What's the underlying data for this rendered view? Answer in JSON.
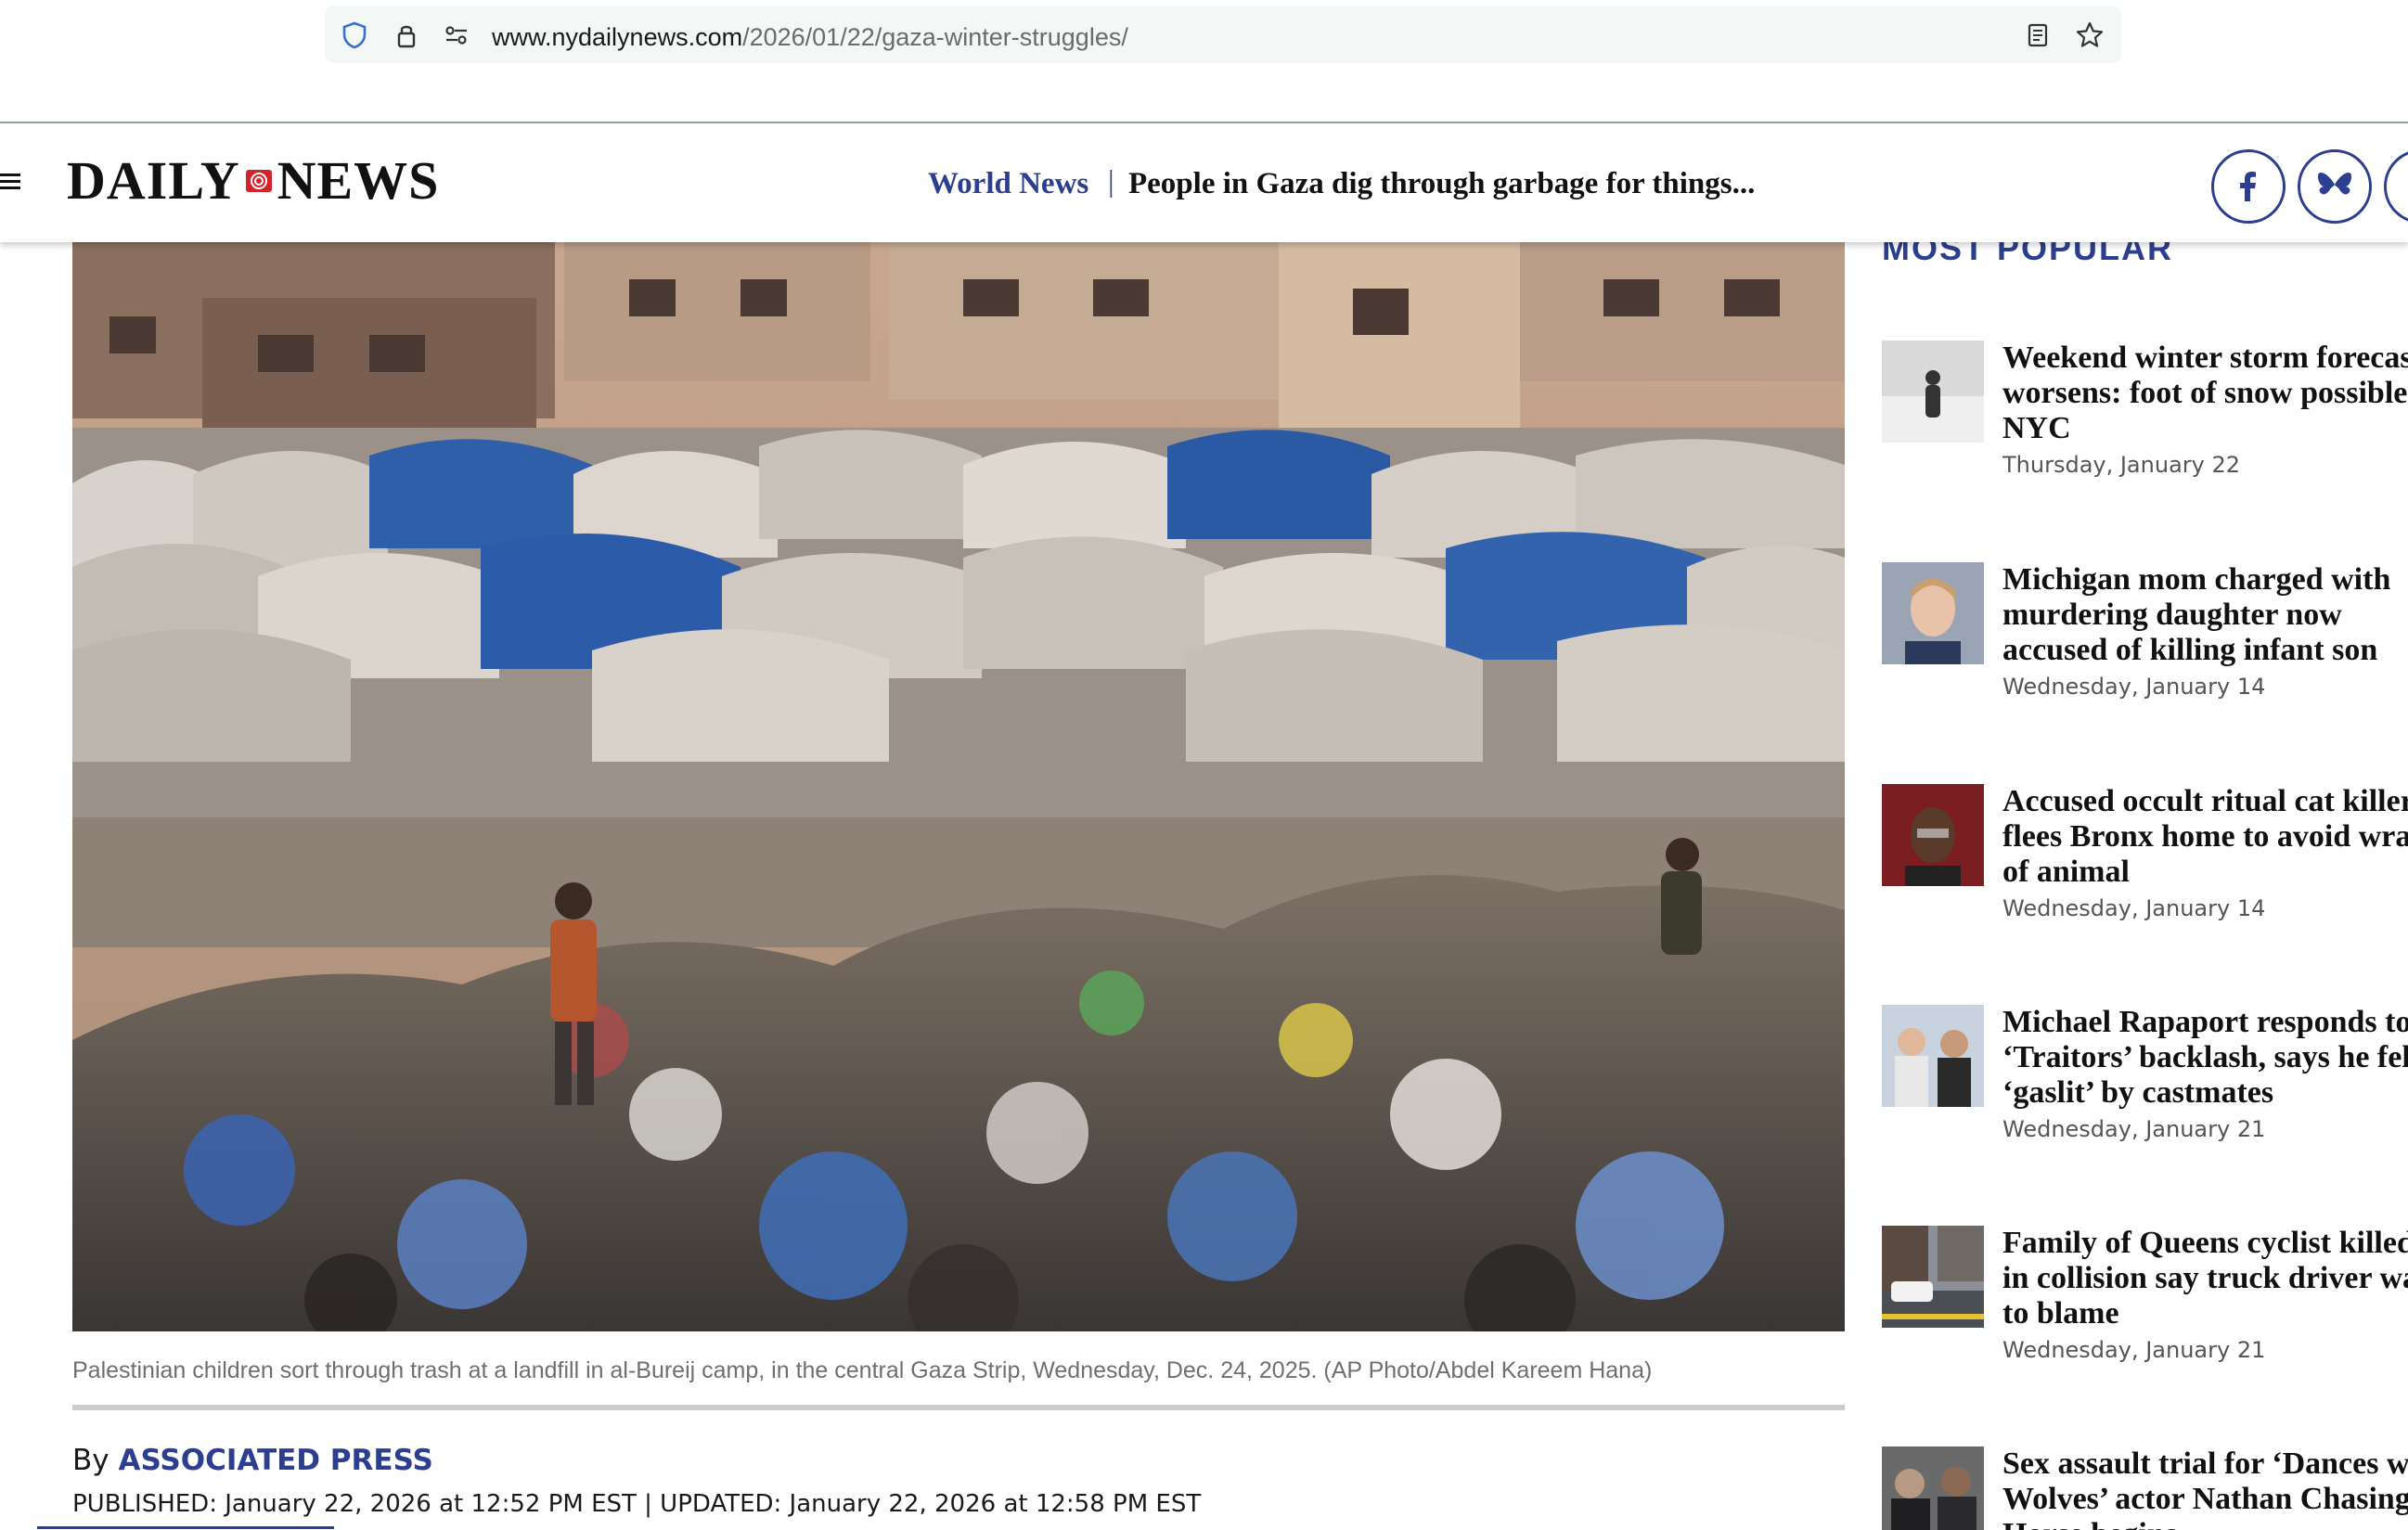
{
  "browser": {
    "url_host": "www.nydailynews.com",
    "url_path": "/2026/01/22/gaza-winter-struggles/"
  },
  "header": {
    "logo_left": "DAILY",
    "logo_right": "NEWS",
    "section": "World News",
    "separator": "|",
    "headline": "People in Gaza dig through garbage for things..."
  },
  "article": {
    "caption": "Palestinian children sort through trash at a landfill in al-Bureij camp, in the central Gaza Strip, Wednesday, Dec. 24, 2025. (AP Photo/Abdel Kareem Hana)",
    "byline_prefix": "By",
    "author": "ASSOCIATED PRESS",
    "dateline": "PUBLISHED: January 22, 2026 at 12:52 PM EST | UPDATED: January 22, 2026 at 12:58 PM EST"
  },
  "sidebar": {
    "title": "MOST POPULAR",
    "stories": [
      {
        "title": "Weekend winter storm forecast worsens: foot of snow possible in NYC",
        "date": "Thursday, January 22"
      },
      {
        "title": "Michigan mom charged with murdering daughter now accused of killing infant son",
        "date": "Wednesday, January 14"
      },
      {
        "title": "Accused occult ritual cat killer flees Bronx home to avoid wrath of animal",
        "date": "Wednesday, January 14"
      },
      {
        "title": "Michael Rapaport responds to ‘Traitors’ backlash, says he felt ‘gaslit’ by castmates",
        "date": "Wednesday, January 21"
      },
      {
        "title": "Family of Queens cyclist killed in collision say truck driver was to blame",
        "date": "Wednesday, January 21"
      },
      {
        "title": "Sex assault trial for ‘Dances with Wolves’ actor Nathan Chasing Horse begins",
        "date": ""
      }
    ]
  },
  "colors": {
    "brand_blue": "#2c3e8f",
    "logo_red": "#d4232b"
  },
  "icons": [
    "shield-icon",
    "lock-icon",
    "permissions-icon",
    "reader-view-icon",
    "bookmark-star-icon",
    "hamburger-menu-icon",
    "facebook-icon",
    "bluesky-icon"
  ]
}
